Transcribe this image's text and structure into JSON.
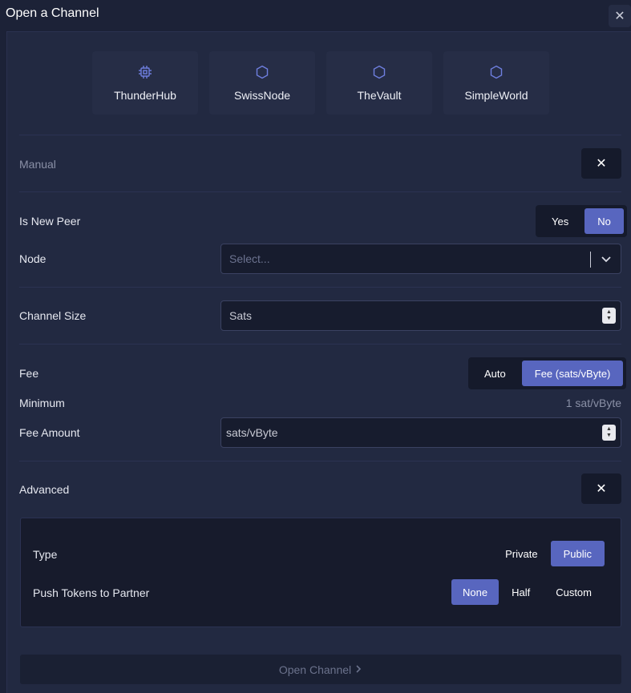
{
  "window": {
    "title": "Open a Channel"
  },
  "presets": [
    {
      "label": "ThunderHub",
      "icon": "cpu-icon"
    },
    {
      "label": "SwissNode",
      "icon": "hexagon-icon"
    },
    {
      "label": "TheVault",
      "icon": "hexagon-icon"
    },
    {
      "label": "SimpleWorld",
      "icon": "hexagon-icon"
    }
  ],
  "manual": {
    "label": "Manual",
    "close_icon": "close-icon"
  },
  "new_peer": {
    "label": "Is New Peer",
    "options": [
      "Yes",
      "No"
    ],
    "selected": "No"
  },
  "node": {
    "label": "Node",
    "placeholder": "Select..."
  },
  "channel_size": {
    "label": "Channel Size",
    "placeholder": "Sats"
  },
  "fee": {
    "label": "Fee",
    "options": [
      "Auto",
      "Fee (sats/vByte)"
    ],
    "selected": "Fee (sats/vByte)"
  },
  "minimum": {
    "label": "Minimum",
    "value": "1 sat/vByte"
  },
  "fee_amount": {
    "label": "Fee Amount",
    "placeholder": "sats/vByte"
  },
  "advanced": {
    "label": "Advanced",
    "type": {
      "label": "Type",
      "options": [
        "Private",
        "Public"
      ],
      "selected": "Public"
    },
    "push_tokens": {
      "label": "Push Tokens to Partner",
      "options": [
        "None",
        "Half",
        "Custom"
      ],
      "selected": "None"
    }
  },
  "open_button": {
    "label": "Open Channel",
    "icon": "chevron-right-icon"
  },
  "colors": {
    "accent": "#5866bf",
    "background": "#1c2237",
    "panel": "#222941"
  }
}
